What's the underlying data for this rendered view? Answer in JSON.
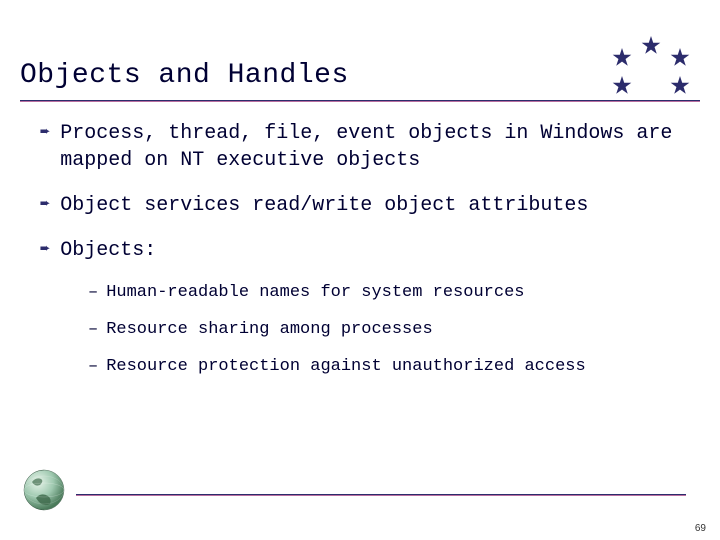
{
  "title": "Objects and Handles",
  "bullets": [
    {
      "text": "Process, thread, file, event objects in Windows are mapped on NT executive objects"
    },
    {
      "text": "Object services read/write object attributes"
    },
    {
      "text": "Objects:"
    }
  ],
  "subbullets": [
    {
      "text": "Human-readable names for system resources"
    },
    {
      "text": "Resource sharing among processes"
    },
    {
      "text": "Resource protection against unauthorized access"
    }
  ],
  "page_number": "69",
  "colors": {
    "ink": "#000033",
    "rule_top": "#2c2c6c",
    "rule_bottom": "#b96fa0",
    "star": "#2c2c6c"
  }
}
